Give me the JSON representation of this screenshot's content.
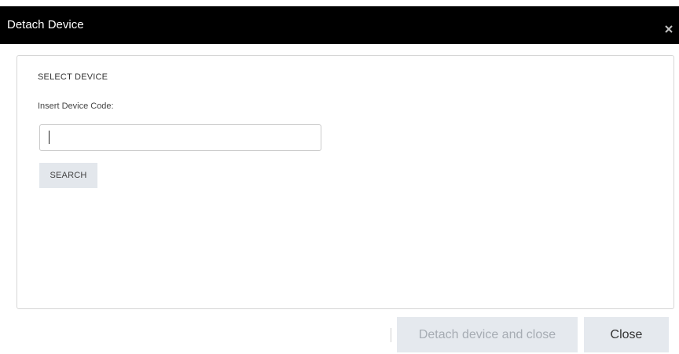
{
  "dialog": {
    "title": "Detach Device",
    "close_icon": "close-icon"
  },
  "panel": {
    "section_title": "SELECT DEVICE",
    "field_label": "Insert Device Code:",
    "input_value": "",
    "input_placeholder": "",
    "search_label": "SEARCH"
  },
  "footer": {
    "detach_label": "Detach device and close",
    "close_label": "Close"
  },
  "colors": {
    "titlebar": "#000000",
    "button_bg": "#e5e9ee",
    "disabled_text": "#a6acb3"
  }
}
